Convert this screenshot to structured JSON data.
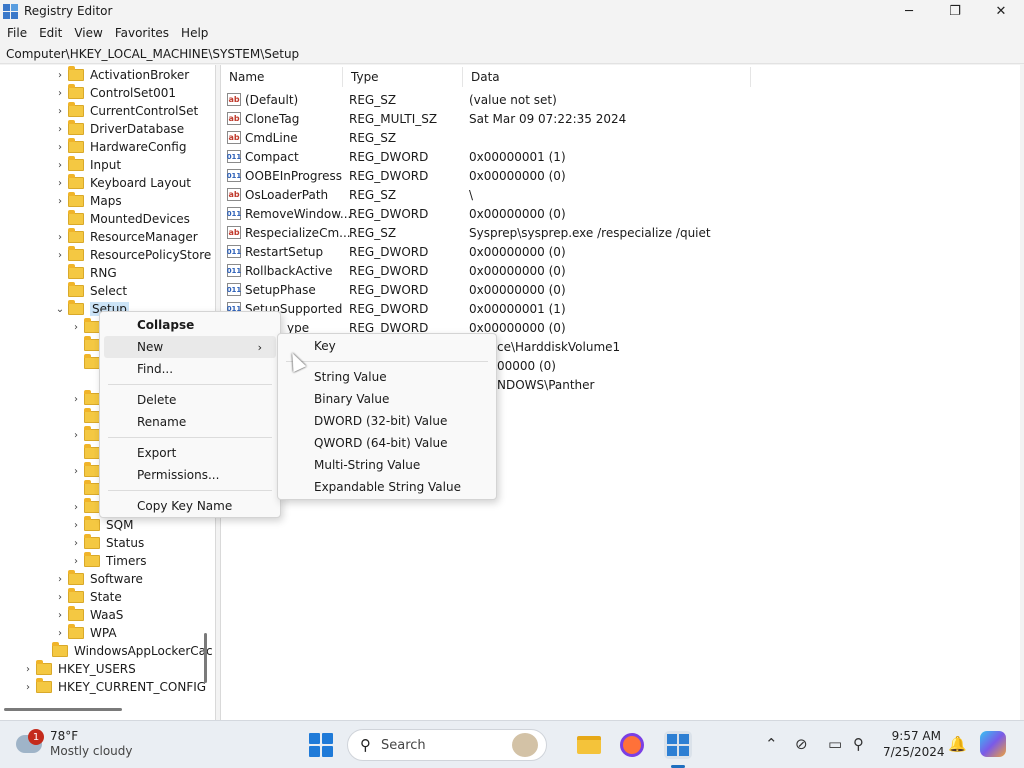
{
  "window": {
    "title": "Registry Editor",
    "minimize_glyph": "─",
    "maximize_glyph": "❐",
    "close_glyph": "✕"
  },
  "menubar": [
    "File",
    "Edit",
    "View",
    "Favorites",
    "Help"
  ],
  "address": "Computer\\HKEY_LOCAL_MACHINE\\SYSTEM\\Setup",
  "tree": {
    "items": [
      {
        "label": "ActivationBroker",
        "chevron": "›"
      },
      {
        "label": "ControlSet001",
        "chevron": "›"
      },
      {
        "label": "CurrentControlSet",
        "chevron": "›"
      },
      {
        "label": "DriverDatabase",
        "chevron": "›"
      },
      {
        "label": "HardwareConfig",
        "chevron": "›"
      },
      {
        "label": "Input",
        "chevron": "›"
      },
      {
        "label": "Keyboard Layout",
        "chevron": "›"
      },
      {
        "label": "Maps",
        "chevron": "›"
      },
      {
        "label": "MountedDevices",
        "chevron": ""
      },
      {
        "label": "ResourceManager",
        "chevron": "›"
      },
      {
        "label": "ResourcePolicyStore",
        "chevron": "›"
      },
      {
        "label": "RNG",
        "chevron": ""
      },
      {
        "label": "Select",
        "chevron": ""
      },
      {
        "label": "Setup",
        "chevron": "⌄"
      },
      {
        "label": "SQM",
        "chevron": "›"
      },
      {
        "label": "Status",
        "chevron": "›"
      },
      {
        "label": "Timers",
        "chevron": "›"
      },
      {
        "label": "Software",
        "chevron": "›"
      },
      {
        "label": "State",
        "chevron": "›"
      },
      {
        "label": "WaaS",
        "chevron": "›"
      },
      {
        "label": "WPA",
        "chevron": "›"
      },
      {
        "label": "WindowsAppLockerCac",
        "chevron": ""
      },
      {
        "label": "HKEY_USERS",
        "chevron": "›"
      },
      {
        "label": "HKEY_CURRENT_CONFIG",
        "chevron": "›"
      }
    ],
    "hidden_child_chevrons": [
      "›",
      "",
      "",
      "›",
      "",
      "›",
      "",
      "›",
      "",
      "›",
      ""
    ]
  },
  "list": {
    "columns": [
      "Name",
      "Type",
      "Data"
    ],
    "rows": [
      {
        "icon": "sz",
        "name": "(Default)",
        "type": "REG_SZ",
        "data": "(value not set)"
      },
      {
        "icon": "sz",
        "name": "CloneTag",
        "type": "REG_MULTI_SZ",
        "data": "Sat Mar 09 07:22:35 2024"
      },
      {
        "icon": "sz",
        "name": "CmdLine",
        "type": "REG_SZ",
        "data": ""
      },
      {
        "icon": "bin",
        "name": "Compact",
        "type": "REG_DWORD",
        "data": "0x00000001 (1)"
      },
      {
        "icon": "bin",
        "name": "OOBEInProgress",
        "type": "REG_DWORD",
        "data": "0x00000000 (0)"
      },
      {
        "icon": "sz",
        "name": "OsLoaderPath",
        "type": "REG_SZ",
        "data": "\\"
      },
      {
        "icon": "bin",
        "name": "RemoveWindow...",
        "type": "REG_DWORD",
        "data": "0x00000000 (0)"
      },
      {
        "icon": "sz",
        "name": "RespecializeCm...",
        "type": "REG_SZ",
        "data": "Sysprep\\sysprep.exe /respecialize /quiet"
      },
      {
        "icon": "bin",
        "name": "RestartSetup",
        "type": "REG_DWORD",
        "data": "0x00000000 (0)"
      },
      {
        "icon": "bin",
        "name": "RollbackActive",
        "type": "REG_DWORD",
        "data": "0x00000000 (0)"
      },
      {
        "icon": "bin",
        "name": "SetupPhase",
        "type": "REG_DWORD",
        "data": "0x00000000 (0)"
      },
      {
        "icon": "bin",
        "name": "SetupSupported",
        "type": "REG_DWORD",
        "data": "0x00000001 (1)"
      },
      {
        "icon": "",
        "name": "ype",
        "type": "REG_DWORD",
        "data": "0x00000000 (0)"
      },
      {
        "icon": "",
        "name": "",
        "type": "",
        "data": "ce\\HarddiskVolume1"
      },
      {
        "icon": "",
        "name": "",
        "type": "",
        "data": "00000 (0)"
      },
      {
        "icon": "",
        "name": "",
        "type": "",
        "data": "NDOWS\\Panther"
      }
    ]
  },
  "context_menu": {
    "collapse": "Collapse",
    "new": "New",
    "find": "Find...",
    "delete": "Delete",
    "rename": "Rename",
    "export": "Export",
    "permissions": "Permissions...",
    "copy_key_name": "Copy Key Name",
    "arrow": "›"
  },
  "submenu": {
    "key": "Key",
    "string_value": "String Value",
    "binary_value": "Binary Value",
    "dword_value": "DWORD (32-bit) Value",
    "qword_value": "QWORD (64-bit) Value",
    "multi_string_value": "Multi-String Value",
    "expandable_string_value": "Expandable String Value"
  },
  "taskbar": {
    "weather_temp": "78°F",
    "weather_condition": "Mostly cloudy",
    "weather_badge": "1",
    "search_label": "Search",
    "search_glyph": "⚲",
    "time": "9:57 AM",
    "date": "7/25/2024",
    "tray_chevron": "⌃",
    "tray_network": "⊘",
    "tray_display": "▭",
    "tray_wifi": "⚲",
    "tray_bell": "🔔"
  }
}
